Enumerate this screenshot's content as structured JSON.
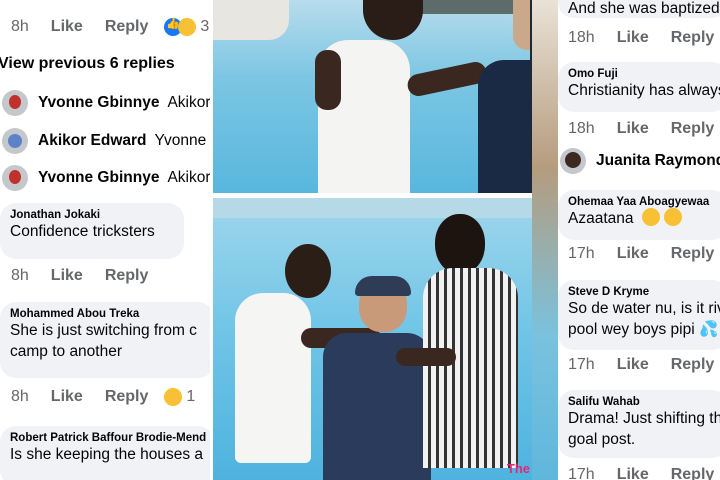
{
  "left": {
    "top_meta": {
      "time": "8h",
      "like": "Like",
      "reply": "Reply",
      "count": "3"
    },
    "previous_replies": "View previous 6 replies",
    "reply_rows": [
      {
        "name": "Yvonne Gbinnye",
        "snippet": "Akikor",
        "avatar": "red"
      },
      {
        "name": "Akikor Edward",
        "snippet": "Yvonne",
        "avatar": "blue"
      },
      {
        "name": "Yvonne Gbinnye",
        "snippet": "Akikor",
        "avatar": "red"
      }
    ],
    "comments": [
      {
        "author": "Jonathan Jokaki",
        "lines": [
          "Confidence tricksters"
        ],
        "time": "8h",
        "like": "Like",
        "reply": "Reply"
      },
      {
        "author": "Mohammed Abou Treka",
        "lines": [
          "She is just switching from c",
          "camp to another"
        ],
        "time": "8h",
        "like": "Like",
        "reply": "Reply",
        "count": "1"
      },
      {
        "author": "Robert Patrick Baffour Brodie-Mend",
        "lines": [
          "Is she keeping the houses a"
        ]
      }
    ]
  },
  "right": {
    "top_text": "And she was baptized",
    "comments": [
      {
        "time": "18h",
        "like": "Like",
        "reply": "Reply"
      },
      {
        "author": "Omo Fuji",
        "lines": [
          "Christianity has always"
        ],
        "time": "18h",
        "like": "Like",
        "reply": "Reply"
      },
      {
        "reply_name": "Juanita Raymond C"
      },
      {
        "author": "Ohemaa Yaa Aboagyewaa",
        "lines": [
          "Azaatana"
        ],
        "time": "17h",
        "like": "Like",
        "reply": "Reply"
      },
      {
        "author": "Steve D Kryme",
        "lines": [
          "So de water nu, is it riv",
          "pool wey boys pipi"
        ],
        "time": "17h",
        "like": "Like",
        "reply": "Reply"
      },
      {
        "author": "Salifu Wahab",
        "lines": [
          "Drama! Just shifting th",
          "goal post."
        ],
        "time": "17h",
        "like": "Like",
        "reply": "Reply"
      }
    ]
  },
  "photo_watermark": "The"
}
